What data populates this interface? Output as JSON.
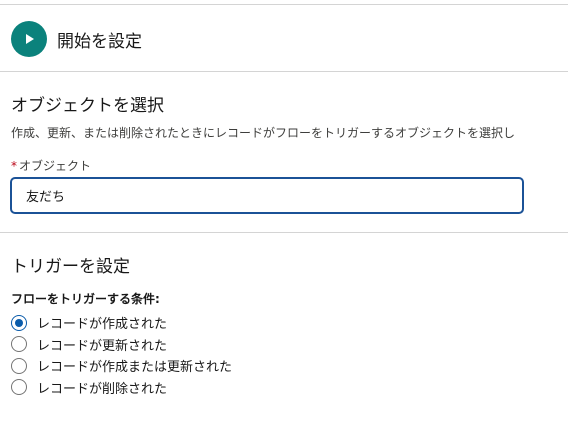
{
  "header": {
    "title": "開始を設定",
    "icon": "play-icon",
    "icon_color": "#0b827c"
  },
  "object_section": {
    "title": "オブジェクトを選択",
    "description": "作成、更新、または削除されたときにレコードがフローをトリガーするオブジェクトを選択し",
    "field_label": "オブジェクト",
    "required_marker": "*",
    "field_value": "友だち"
  },
  "trigger_section": {
    "title": "トリガーを設定",
    "group_label": "フローをトリガーする条件:",
    "options": [
      {
        "label": "レコードが作成された",
        "selected": true
      },
      {
        "label": "レコードが更新された",
        "selected": false
      },
      {
        "label": "レコードが作成または更新された",
        "selected": false
      },
      {
        "label": "レコードが削除された",
        "selected": false
      }
    ]
  },
  "colors": {
    "accent": "#0b5cab",
    "input_focus_border": "#1b5297",
    "required": "#ba0517",
    "divider": "#d4d4d4"
  }
}
